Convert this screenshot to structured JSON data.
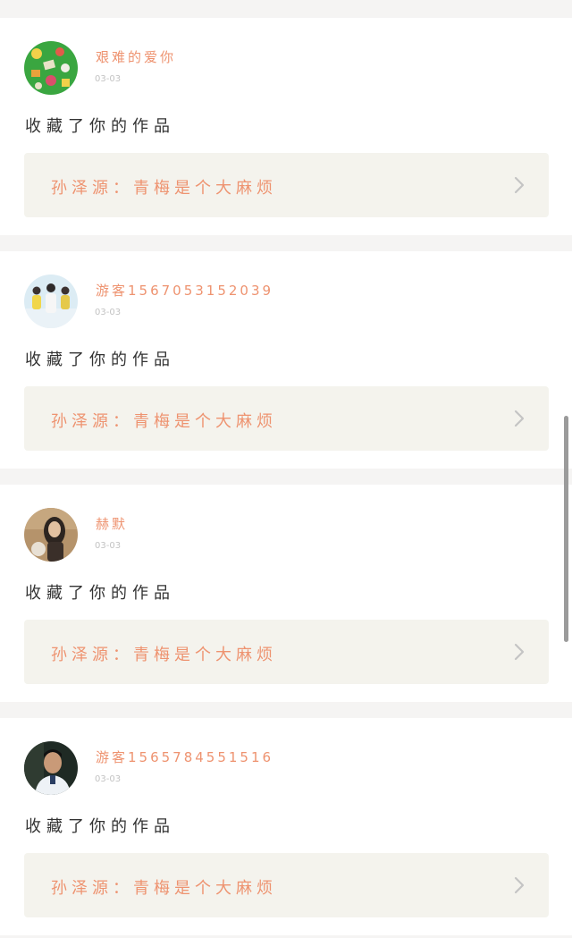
{
  "feed": {
    "items": [
      {
        "username": "艰难的爱你",
        "date": "03-03",
        "action": "收藏了你的作品",
        "work_title": "孙泽源：青梅是个大麻烦"
      },
      {
        "username": "游客1567053152039",
        "date": "03-03",
        "action": "收藏了你的作品",
        "work_title": "孙泽源：青梅是个大麻烦"
      },
      {
        "username": "赫默",
        "date": "03-03",
        "action": "收藏了你的作品",
        "work_title": "孙泽源：青梅是个大麻烦"
      },
      {
        "username": "游客1565784551516",
        "date": "03-03",
        "action": "收藏了你的作品",
        "work_title": "孙泽源：青梅是个大麻烦"
      }
    ]
  },
  "colors": {
    "accent": "#ee9370",
    "background": "#f5f4f3",
    "card": "#ffffff",
    "link_background": "#f4f3ed",
    "action_text": "#333333",
    "date_text": "#c3c3c3"
  },
  "icons": {
    "item_arrow": "chevron-right-icon"
  }
}
